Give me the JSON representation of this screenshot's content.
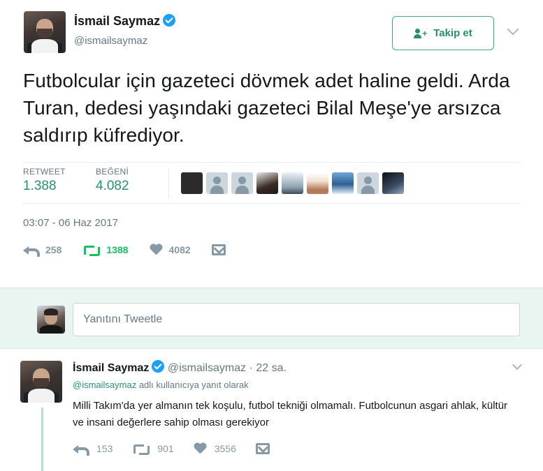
{
  "main_tweet": {
    "author_name": "İsmail Saymaz",
    "author_handle": "@ismailsaymaz",
    "follow_label": "Takip et",
    "text": "Futbolcular için gazeteci dövmek adet haline geldi. Arda Turan, dedesi yaşındaki gazeteci Bilal Meşe'ye arsızca saldırıp küfrediyor.",
    "stats": {
      "retweet_label": "RETWEET",
      "retweet_value": "1.388",
      "like_label": "BEĞENİ",
      "like_value": "4.082"
    },
    "timestamp": "03:07 - 06 Haz 2017",
    "actions": {
      "reply_count": "258",
      "retweet_count": "1388",
      "like_count": "4082"
    }
  },
  "reply_box": {
    "placeholder": "Yanıtını Tweetle"
  },
  "reply_tweet": {
    "author_name": "İsmail Saymaz",
    "author_handle": "@ismailsaymaz",
    "separator": "·",
    "time": "22 sa.",
    "context_mention": "@ismailsaymaz",
    "context_text": " adlı kullanıcıya yanıt olarak",
    "text": "Milli Takım'da yer almanın tek koşulu, futbol tekniği olmamalı. Futbolcunun asgari ahlak, kültür ve insani değerlere sahip olması gerekiyor",
    "actions": {
      "reply_count": "153",
      "retweet_count": "901",
      "like_count": "3556"
    }
  },
  "colors": {
    "accent_green": "#2a8f72",
    "retweet_active": "#17bf63",
    "verified_blue": "#1da1f2",
    "reply_bg": "#e8f5f0"
  }
}
